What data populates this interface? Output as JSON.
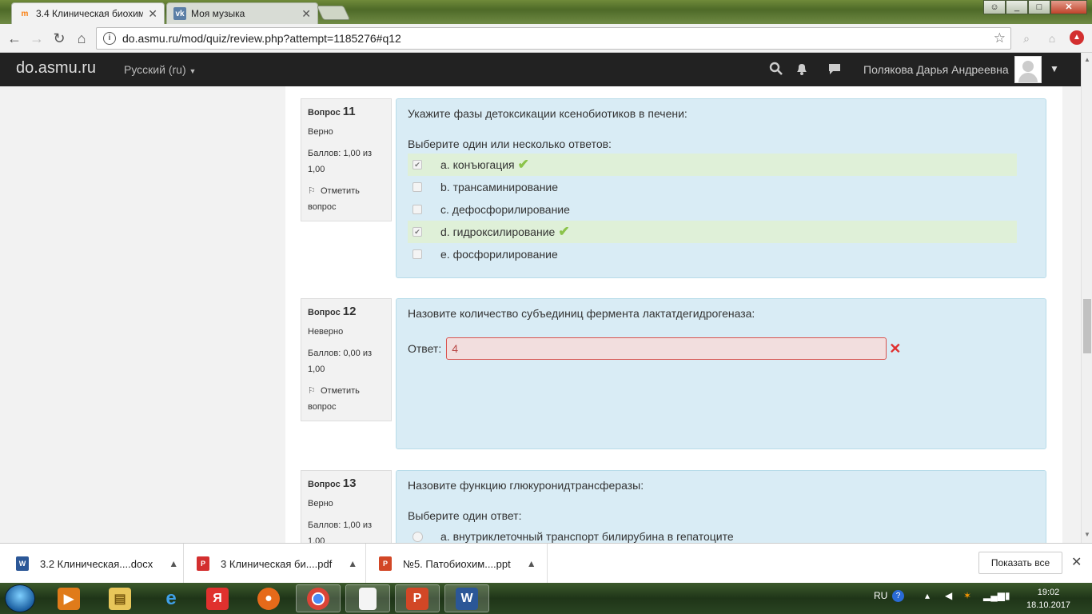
{
  "browser": {
    "tabs": [
      {
        "title": "3.4 Клиническая биохим",
        "favicon": "moodle-icon",
        "active": true
      },
      {
        "title": "Моя музыка",
        "favicon": "vk-icon",
        "active": false
      }
    ],
    "url": "do.asmu.ru/mod/quiz/review.php?attempt=1185276#q12"
  },
  "navbar": {
    "brand": "do.asmu.ru",
    "language": "Русский (ru)",
    "user_name": "Полякова Дарья Андреевна"
  },
  "questions": [
    {
      "number_label": "Вопрос",
      "number": "11",
      "status": "Верно",
      "grade": "Баллов: 1,00 из 1,00",
      "flag_label": "Отметить вопрос",
      "text": "Укажите фазы детоксикации ксенобиотиков в печени:",
      "prompt": "Выберите один или несколько ответов:",
      "options": [
        {
          "label": "a. конъюгация",
          "checked": true,
          "correct": true
        },
        {
          "label": "b. трансаминирование",
          "checked": false,
          "correct": false
        },
        {
          "label": "c. дефосфорилирование",
          "checked": false,
          "correct": false
        },
        {
          "label": "d. гидроксилирование",
          "checked": true,
          "correct": true
        },
        {
          "label": "e. фосфорилирование",
          "checked": false,
          "correct": false
        }
      ]
    },
    {
      "number_label": "Вопрос",
      "number": "12",
      "status": "Неверно",
      "grade": "Баллов: 0,00 из 1,00",
      "flag_label": "Отметить вопрос",
      "text": "Назовите количество субъединиц фермента лактатдегидрогеназа:",
      "answer_label": "Ответ:",
      "answer_value": "4"
    },
    {
      "number_label": "Вопрос",
      "number": "13",
      "status": "Верно",
      "grade": "Баллов: 1,00 из 1,00",
      "text": "Назовите функцию глюкуронидтрансферазы:",
      "prompt": "Выберите один ответ:",
      "options": [
        {
          "label": "a. внутриклеточный транспорт билирубина в гепатоците"
        }
      ]
    }
  ],
  "downloads": {
    "items": [
      {
        "name": "3.2 Клиническая....docx",
        "icon": "word-doc-icon",
        "color": "#2b5797"
      },
      {
        "name": "3 Клиническая би....pdf",
        "icon": "pdf-icon",
        "color": "#d32f2f"
      },
      {
        "name": "№5. Патобиохим....ppt",
        "icon": "ppt-icon",
        "color": "#d24726"
      }
    ],
    "show_all": "Показать все"
  },
  "taskbar": {
    "lang": "RU",
    "time": "19:02",
    "date": "18.10.2017"
  }
}
